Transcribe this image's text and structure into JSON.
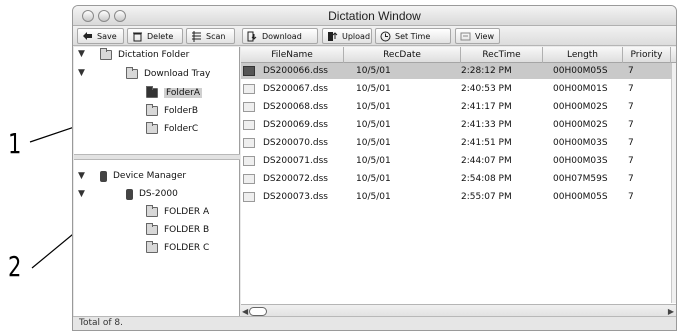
{
  "window": {
    "title": "Dictation Window"
  },
  "toolbar": {
    "save": "Save",
    "delete": "Delete",
    "scan": "Scan",
    "download": "Download",
    "upload": "Upload",
    "set_time": "Set Time",
    "view": "View"
  },
  "tree": {
    "dictation_folder": "Dictation Folder",
    "download_tray": "Download Tray",
    "folder_a": "FolderA",
    "folder_b": "FolderB",
    "folder_c": "FolderC",
    "device_manager": "Device Manager",
    "device": "DS-2000",
    "dev_folder_a": "FOLDER A",
    "dev_folder_b": "FOLDER B",
    "dev_folder_c": "FOLDER C"
  },
  "table": {
    "columns": [
      "FileName",
      "RecDate",
      "RecTime",
      "Length",
      "Priority"
    ],
    "rows": [
      [
        "DS200066.dss",
        "10/5/01",
        "2:28:12 PM",
        "00H00M05S",
        "7"
      ],
      [
        "DS200067.dss",
        "10/5/01",
        "2:40:53 PM",
        "00H00M01S",
        "7"
      ],
      [
        "DS200068.dss",
        "10/5/01",
        "2:41:17 PM",
        "00H00M02S",
        "7"
      ],
      [
        "DS200069.dss",
        "10/5/01",
        "2:41:33 PM",
        "00H00M02S",
        "7"
      ],
      [
        "DS200070.dss",
        "10/5/01",
        "2:41:51 PM",
        "00H00M03S",
        "7"
      ],
      [
        "DS200071.dss",
        "10/5/01",
        "2:44:07 PM",
        "00H00M03S",
        "7"
      ],
      [
        "DS200072.dss",
        "10/5/01",
        "2:54:08 PM",
        "00H07M59S",
        "7"
      ],
      [
        "DS200073.dss",
        "10/5/01",
        "2:55:07 PM",
        "00H00M05S",
        "7"
      ]
    ]
  },
  "status": {
    "text": "Total of 8."
  },
  "callouts": {
    "one": "1",
    "two": "2"
  }
}
